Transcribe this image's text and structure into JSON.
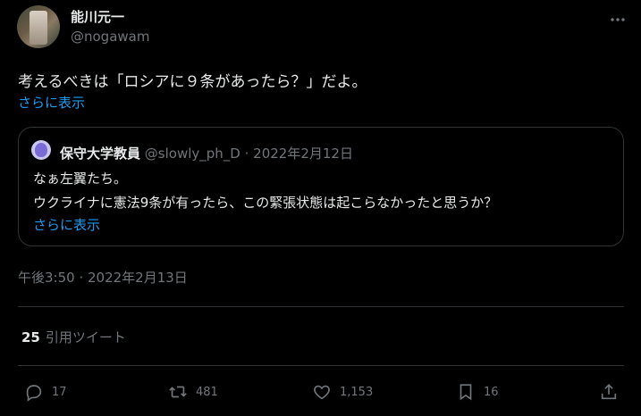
{
  "author": {
    "display_name": "能川元一",
    "handle": "@nogawam"
  },
  "tweet": {
    "text": "考えるべきは「ロシアに９条があったら？」だよ。",
    "show_more": "さらに表示",
    "timestamp": "午後3:50 · 2022年2月13日"
  },
  "quoted": {
    "display_name": "保守大学教員",
    "meta": "@slowly_ph_D · 2022年2月12日",
    "line1": "なぁ左翼たち。",
    "line2": "ウクライナに憲法9条が有ったら、この緊張状態は起こらなかったと思うか？",
    "show_more": "さらに表示"
  },
  "stats": {
    "quote_count": "25",
    "quote_label": "引用ツイート"
  },
  "actions": {
    "reply_count": "17",
    "retweet_count": "481",
    "like_count": "1,153",
    "bookmark_count": "16"
  },
  "colors": {
    "background": "#000000",
    "link": "#1d9bf0",
    "muted": "#71767b",
    "border": "#2f3336"
  },
  "icons": [
    "more-icon",
    "reply-icon",
    "retweet-icon",
    "like-icon",
    "bookmark-icon",
    "share-icon"
  ]
}
